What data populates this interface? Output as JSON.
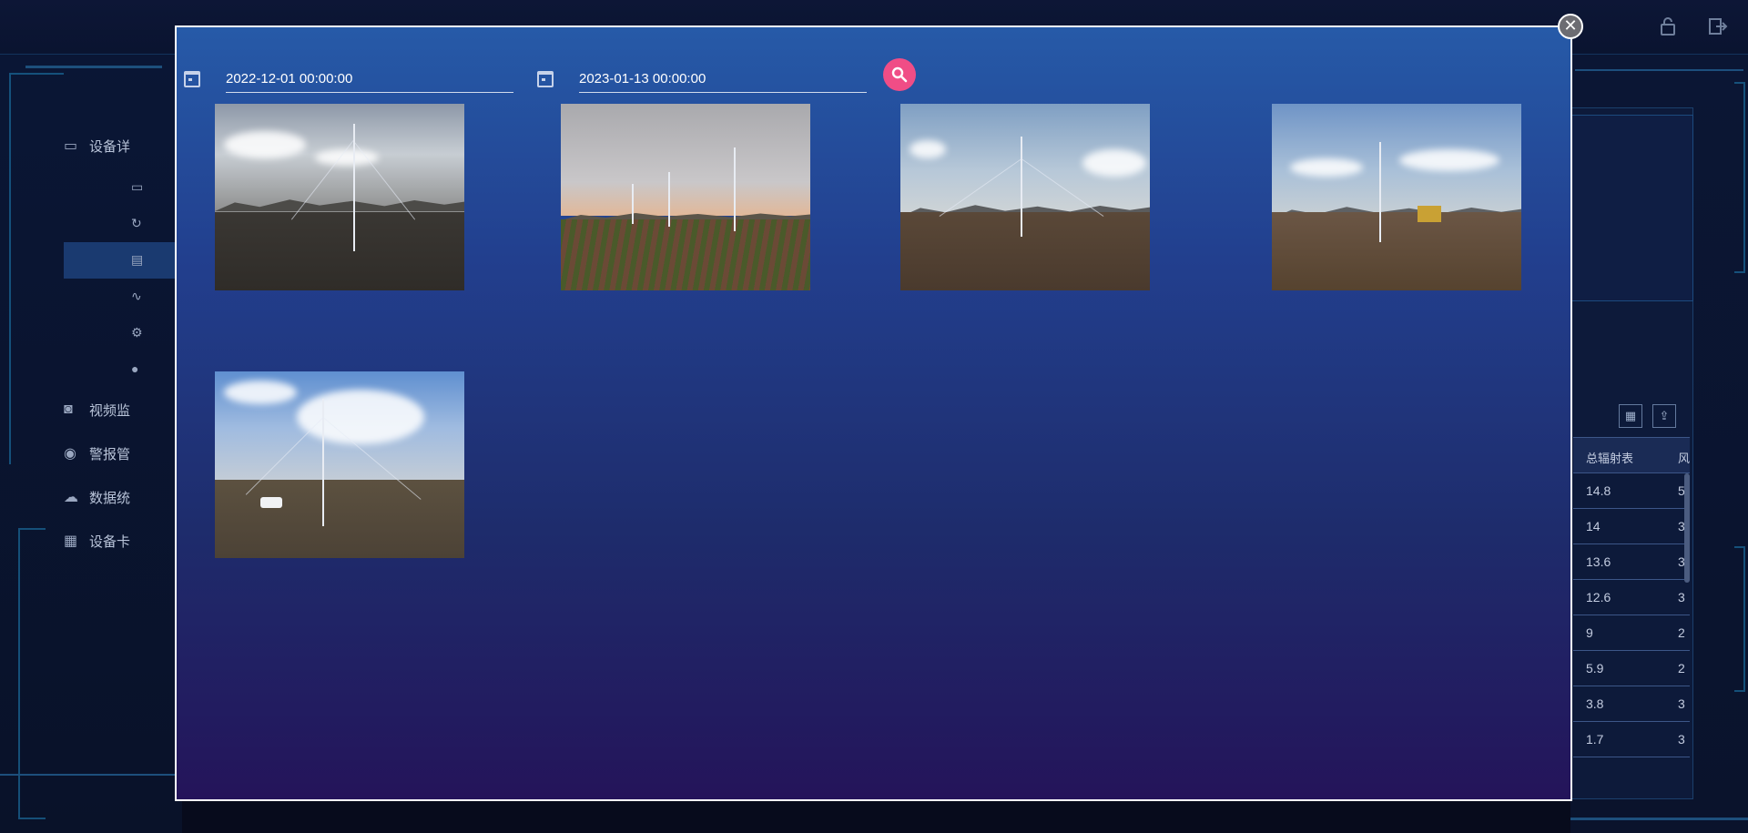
{
  "nav": {
    "items": [
      {
        "label": "设备详",
        "icon": "devices-icon"
      },
      {
        "label": "视频监",
        "icon": "camera-icon"
      },
      {
        "label": "警报管",
        "icon": "user-circle-icon"
      },
      {
        "label": "数据统",
        "icon": "cloud-icon"
      },
      {
        "label": "设备卡",
        "icon": "card-icon"
      }
    ],
    "sub_icons": [
      "devices-icon",
      "refresh-icon",
      "monitor-icon",
      "trend-icon",
      "gear-icon",
      "location-pin-icon"
    ]
  },
  "table": {
    "headers": [
      "总辐射表",
      "风"
    ],
    "rows": [
      [
        "14.8",
        "5"
      ],
      [
        "14",
        "3"
      ],
      [
        "13.6",
        "3"
      ],
      [
        "12.6",
        "3"
      ],
      [
        "9",
        "2"
      ],
      [
        "5.9",
        "2"
      ],
      [
        "3.8",
        "3"
      ],
      [
        "1.7",
        "3"
      ]
    ]
  },
  "filter": {
    "start_date": "2022-12-01 00:00:00",
    "end_date": "2023-01-13 00:00:00"
  },
  "photos": [
    {
      "name": "weather-station-photo-1"
    },
    {
      "name": "weather-station-photo-2"
    },
    {
      "name": "weather-station-photo-3"
    },
    {
      "name": "weather-station-photo-4"
    },
    {
      "name": "weather-station-photo-5"
    }
  ],
  "colors": {
    "accent_pink": "#f04d86",
    "modal_top": "#265aa8",
    "modal_bottom": "#24145a"
  }
}
